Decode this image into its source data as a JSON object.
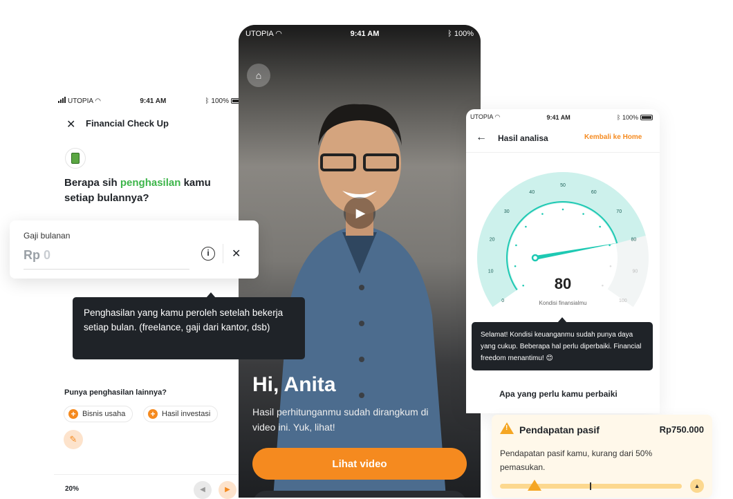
{
  "left_screen": {
    "status": {
      "carrier": "UTOPIA",
      "time": "9:41 AM",
      "battery": "100%"
    },
    "title": "Financial Check Up",
    "question_pre": "Berapa sih ",
    "question_highlight": "penghasilan",
    "question_post": " kamu setiap bulannya?",
    "input_card": {
      "label": "Gaji bulanan",
      "prefix": "Rp",
      "value": "0"
    },
    "tooltip": "Penghasilan yang kamu peroleh setelah bekerja setiap bulan. (freelance, gaji dari kantor, dsb)",
    "other_income_title": "Punya penghasilan lainnya?",
    "chips": [
      "Bisnis usaha",
      "Hasil investasi"
    ],
    "progress_label": "20%"
  },
  "video_screen": {
    "status": {
      "carrier": "UTOPIA",
      "time": "9:41 AM",
      "battery": "100%"
    },
    "greeting": "Hi, Anita",
    "subtitle": "Hasil perhitunganmu sudah dirangkum di video ini. Yuk, lihat!",
    "cta_label": "Lihat video"
  },
  "result_screen": {
    "status": {
      "carrier": "UTOPIA",
      "time": "9:41 AM",
      "battery": "100%"
    },
    "title": "Hasil analisa",
    "home_link": "Kembali ke Home",
    "gauge": {
      "value": 80,
      "min": 0,
      "max": 100,
      "ticks": [
        "0",
        "10",
        "20",
        "30",
        "40",
        "50",
        "60",
        "70",
        "80",
        "90",
        "100"
      ],
      "caption": "Kondisi finansialmu",
      "accent": "#1ec9b3"
    },
    "tooltip": "Selamat! Kondisi keuanganmu sudah punya daya yang cukup. Beberapa hal perlu diperbaiki. Financial freedom menantimu! 😊",
    "improve_title": "Apa yang perlu kamu perbaiki",
    "card": {
      "title": "Pendapatan pasif",
      "amount": "Rp750.000",
      "desc": "Pendapatan pasif kamu, kurang dari 50% pemasukan."
    }
  },
  "colors": {
    "orange": "#f58a1f",
    "green": "#3db54a",
    "teal": "#1ec9b3",
    "dark": "#1f2328"
  }
}
